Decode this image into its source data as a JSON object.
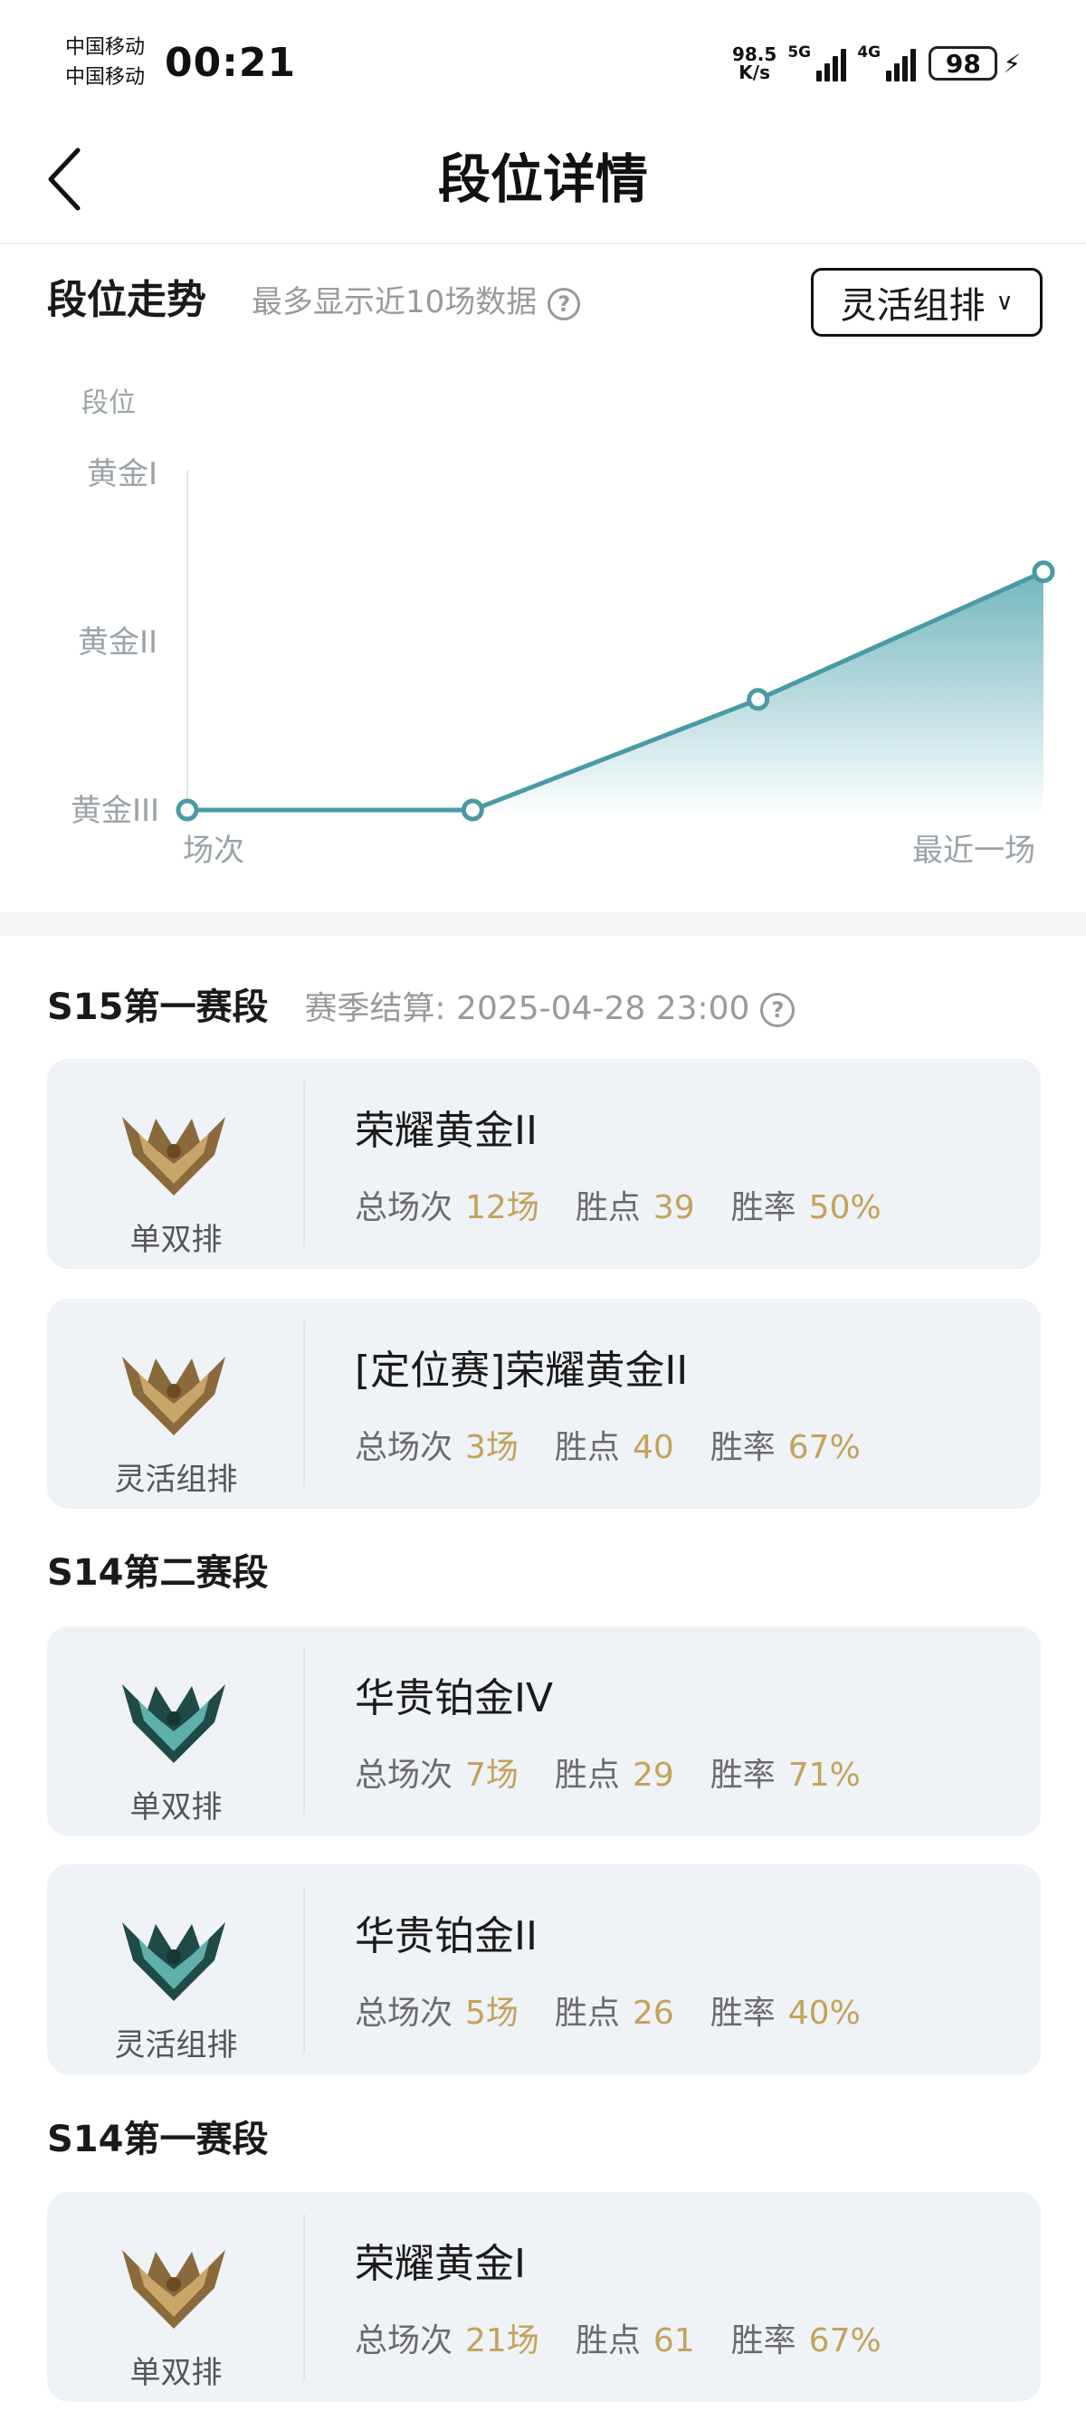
{
  "status_bar": {
    "carrier1": "中国移动",
    "carrier2": "中国移动",
    "time": "00:21",
    "net_speed_value": "98.5",
    "net_speed_unit": "K/s",
    "sig1_label": "5G",
    "sig2_label": "4G",
    "battery": "98"
  },
  "header": {
    "title": "段位详情"
  },
  "trend": {
    "title": "段位走势",
    "subtitle": "最多显示近10场数据",
    "mode": "灵活组排"
  },
  "chart_data": {
    "type": "area",
    "ylabel": "段位",
    "yticks": [
      "黄金III",
      "黄金II",
      "黄金I"
    ],
    "x_start_label": "场次",
    "x_end_label": "最近一场",
    "values": [
      0,
      0,
      0.65,
      1.4
    ],
    "colors": {
      "line": "#4a9aa5",
      "fill_top": "#5aaab3",
      "point_fill": "#ffffff"
    }
  },
  "seasons": [
    {
      "title": "S15第一赛段",
      "note": "赛季结算: 2025-04-28 23:00",
      "cards": [
        {
          "queue": "单双排",
          "rank": "荣耀黄金II",
          "games_label": "总场次",
          "games": "12场",
          "points_label": "胜点",
          "points": "39",
          "rate_label": "胜率",
          "rate": "50%",
          "tier": "gold"
        },
        {
          "queue": "灵活组排",
          "rank": "[定位赛]荣耀黄金II",
          "games_label": "总场次",
          "games": "3场",
          "points_label": "胜点",
          "points": "40",
          "rate_label": "胜率",
          "rate": "67%",
          "tier": "gold"
        }
      ]
    },
    {
      "title": "S14第二赛段",
      "cards": [
        {
          "queue": "单双排",
          "rank": "华贵铂金IV",
          "games_label": "总场次",
          "games": "7场",
          "points_label": "胜点",
          "points": "29",
          "rate_label": "胜率",
          "rate": "71%",
          "tier": "platinum"
        },
        {
          "queue": "灵活组排",
          "rank": "华贵铂金II",
          "games_label": "总场次",
          "games": "5场",
          "points_label": "胜点",
          "points": "26",
          "rate_label": "胜率",
          "rate": "40%",
          "tier": "platinum"
        }
      ]
    },
    {
      "title": "S14第一赛段",
      "cards": [
        {
          "queue": "单双排",
          "rank": "荣耀黄金I",
          "games_label": "总场次",
          "games": "21场",
          "points_label": "胜点",
          "points": "61",
          "rate_label": "胜率",
          "rate": "67%",
          "tier": "gold"
        }
      ]
    }
  ]
}
